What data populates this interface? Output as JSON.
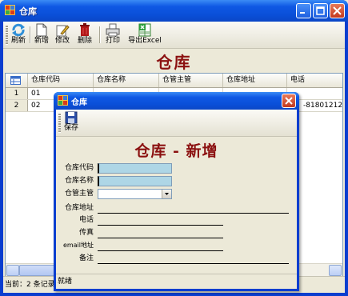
{
  "window": {
    "title": "仓库",
    "icon": "warehouse-app-icon"
  },
  "toolbar": {
    "refresh": "刷新",
    "new": "新增",
    "edit": "修改",
    "delete": "删除",
    "print": "打印",
    "export": "导出Excel"
  },
  "heading": "仓库",
  "grid": {
    "columns": [
      "仓库代码",
      "仓库名称",
      "仓管主管",
      "仓库地址",
      "电话"
    ],
    "rows": [
      {
        "num": "1",
        "code": "01",
        "phone": ""
      },
      {
        "num": "2",
        "code": "02",
        "phone": "-81801212"
      }
    ]
  },
  "statusbar": {
    "text": "当前：2 条记录"
  },
  "dialog": {
    "title": "仓库",
    "save": "保存",
    "heading": "仓库 - 新增",
    "fields": {
      "code": "仓库代码",
      "name": "仓库名称",
      "manager": "仓管主管",
      "address": "仓库地址",
      "phone": "电话",
      "fax": "传真",
      "email": "email地址",
      "remark": "备注"
    },
    "status": "就绪"
  }
}
